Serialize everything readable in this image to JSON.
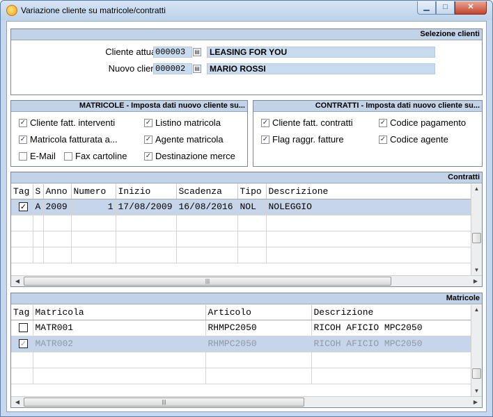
{
  "window": {
    "title": "Variazione cliente su matricole/contratti"
  },
  "selezione": {
    "header": "Selezione clienti",
    "current_label": "Cliente attuale:",
    "current_code": "000003",
    "current_name": "LEASING FOR YOU",
    "new_label": "Nuovo cliente:",
    "new_code": "000002",
    "new_name": "MARIO ROSSI"
  },
  "matricole_opts": {
    "header": "MATRICOLE - Imposta dati nuovo cliente su...",
    "items": [
      {
        "label": "Cliente fatt. interventi",
        "checked": true
      },
      {
        "label": "Listino matricola",
        "checked": true
      },
      {
        "label": "Matricola fatturata a...",
        "checked": true
      },
      {
        "label": "Agente matricola",
        "checked": true
      },
      {
        "label": "E-Mail",
        "checked": false
      },
      {
        "label": "Fax cartoline",
        "checked": false
      },
      {
        "label": "Destinazione merce",
        "checked": true
      }
    ]
  },
  "contratti_opts": {
    "header": "CONTRATTI - Imposta dati nuovo cliente su...",
    "items": [
      {
        "label": "Cliente fatt. contratti",
        "checked": true
      },
      {
        "label": "Codice pagamento",
        "checked": true
      },
      {
        "label": "Flag raggr. fatture",
        "checked": true
      },
      {
        "label": "Codice agente",
        "checked": true
      }
    ]
  },
  "contratti": {
    "header": "Contratti",
    "columns": [
      "Tag",
      "S",
      "Anno",
      "Numero",
      "Inizio",
      "Scadenza",
      "Tipo",
      "Descrizione"
    ],
    "rows": [
      {
        "tag": "✓",
        "s": "A",
        "anno": "2009",
        "numero": "1",
        "inizio": "17/08/2009",
        "scadenza": "16/08/2016",
        "tipo": "NOL",
        "descrizione": "NOLEGGIO"
      }
    ]
  },
  "matricole": {
    "header": "Matricole",
    "columns": [
      "Tag",
      "Matricola",
      "Articolo",
      "Descrizione"
    ],
    "rows": [
      {
        "tag": "",
        "matricola": "MATR001",
        "articolo": "RHMPC2050",
        "descrizione": "RICOH AFICIO MPC2050"
      },
      {
        "tag": "✓",
        "matricola": "MATR002",
        "articolo": "RHMPC2050",
        "descrizione": "RICOH AFICIO MPC2050"
      }
    ]
  },
  "icons": {
    "app": "app-icon",
    "lookup": "lookup-icon",
    "check": "check-icon"
  },
  "colors": {
    "field_bg": "#c9dcef",
    "header_bg": "#c2d2e7",
    "selected_row": "#c6d5ea"
  }
}
